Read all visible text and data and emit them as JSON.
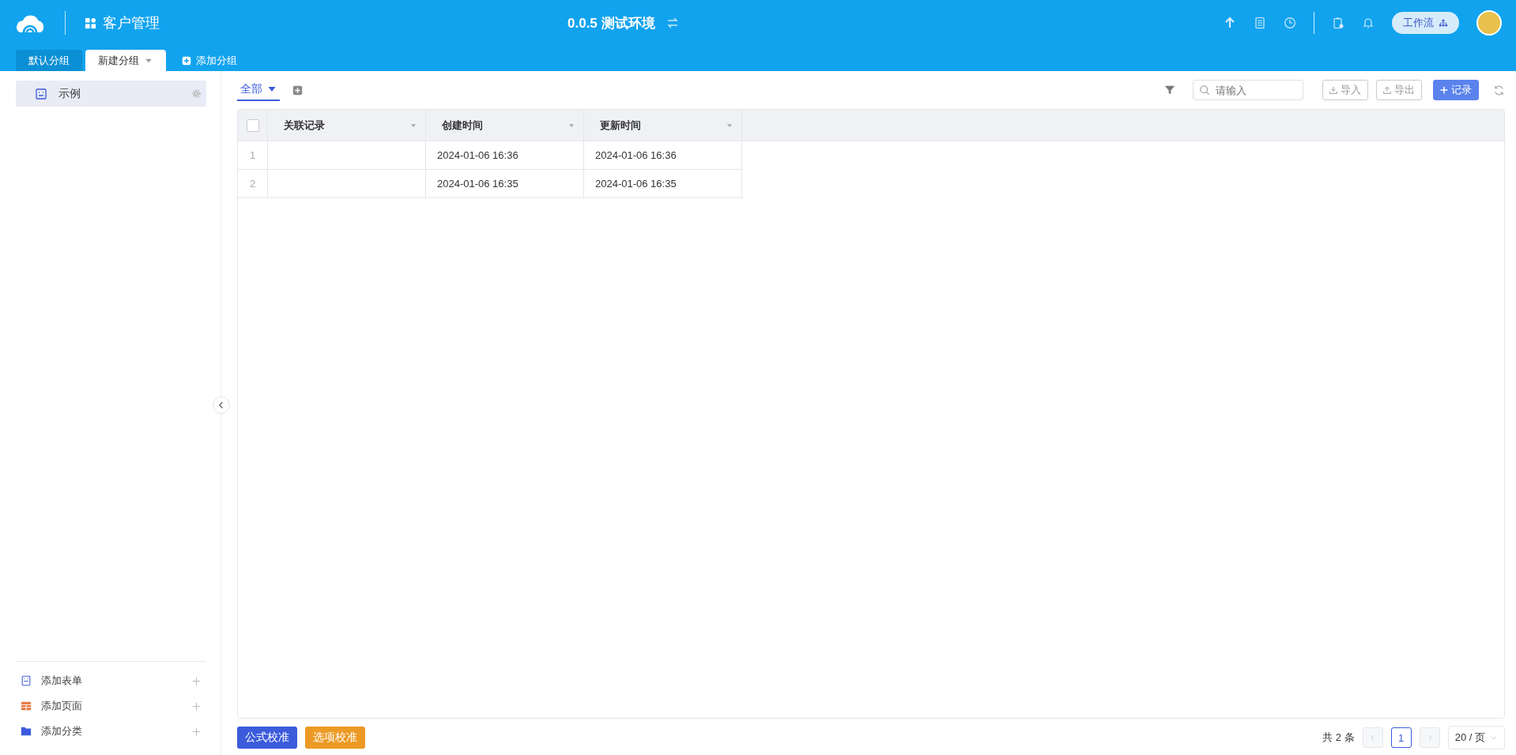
{
  "app": {
    "title": "客户管理",
    "environment": "0.0.5 测试环境",
    "workflow_button": "工作流"
  },
  "group_tabs": [
    {
      "label": "默认分组",
      "selected": false
    },
    {
      "label": "新建分组",
      "selected": true
    }
  ],
  "add_group": "添加分组",
  "sidebar": {
    "items": [
      {
        "label": "示例",
        "selected": true
      }
    ],
    "footer": [
      {
        "kind": "form",
        "label": "添加表单"
      },
      {
        "kind": "page",
        "label": "添加页面"
      },
      {
        "kind": "category",
        "label": "添加分类"
      }
    ]
  },
  "toolbar": {
    "views": [
      {
        "label": "全部",
        "selected": true
      }
    ],
    "search": {
      "placeholder": "请输入"
    },
    "import": "导入",
    "export": "导出",
    "add_record": "记录"
  },
  "table": {
    "select_all": {
      "checked": false
    },
    "columns": [
      "关联记录",
      "创建时间",
      "更新时间"
    ],
    "rows": [
      {
        "number": "1",
        "created_time": "2024-01-06 16:36",
        "updated_time": "2024-01-06 16:36"
      },
      {
        "number": "2",
        "created_time": "2024-01-06 16:35",
        "updated_time": "2024-01-06 16:35"
      }
    ]
  },
  "footer": {
    "buttons": [
      {
        "kind": "primary",
        "label": "公式校准"
      },
      {
        "kind": "warning",
        "label": "选项校准"
      }
    ],
    "total": "共 2 条",
    "pages": [
      {
        "label": "1",
        "selected": true
      }
    ],
    "page_size": "20 / 页"
  }
}
